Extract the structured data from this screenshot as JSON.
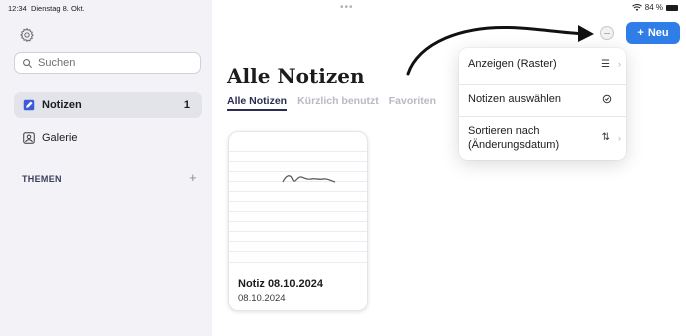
{
  "status": {
    "time": "12:34",
    "date": "Dienstag 8. Okt.",
    "battery": "84 %"
  },
  "sidebar": {
    "search_placeholder": "Suchen",
    "items": [
      {
        "label": "Notizen",
        "count": "1",
        "icon": "note-icon",
        "active": true
      },
      {
        "label": "Galerie",
        "icon": "gallery-icon",
        "active": false
      }
    ],
    "section_label": "THEMEN",
    "add_label": "+"
  },
  "main": {
    "title": "Alle Notizen",
    "tabs": [
      {
        "label": "Alle Notizen",
        "active": true
      },
      {
        "label": "Kürzlich benutzt",
        "active": false
      },
      {
        "label": "Favoriten",
        "active": false
      }
    ],
    "notes": [
      {
        "title": "Notiz 08.10.2024",
        "date": "08.10.2024"
      }
    ]
  },
  "toolbar": {
    "new_label": "Neu",
    "new_icon": "+"
  },
  "menu": {
    "items": [
      {
        "label": "Anzeigen (Raster)",
        "icon": "list-icon",
        "chevron": true
      },
      {
        "label": "Notizen auswählen",
        "icon": "check-circle-icon",
        "chevron": false
      },
      {
        "label": "Sortieren nach (Änderungsdatum)",
        "icon": "sort-icon",
        "chevron": true
      }
    ]
  },
  "colors": {
    "accent": "#2f7ee8",
    "sidebar_bg": "#f2f2f7",
    "title_text": "#2a2d52"
  }
}
